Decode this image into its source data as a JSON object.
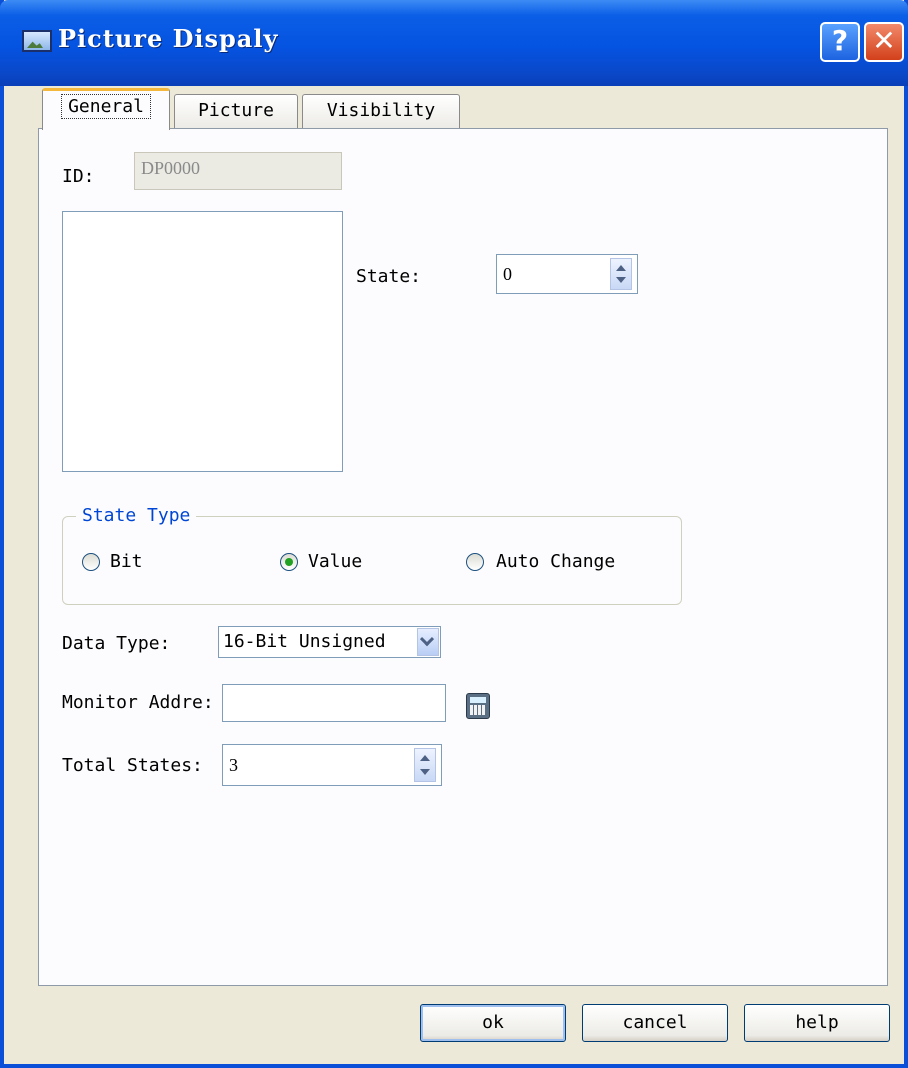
{
  "window": {
    "title": "Picture Dispaly"
  },
  "title_buttons": {
    "help": "?",
    "close": "✕"
  },
  "tabs": [
    {
      "label": "General"
    },
    {
      "label": "Picture"
    },
    {
      "label": "Visibility"
    }
  ],
  "general": {
    "id_label": "ID:",
    "id_value": "DP0000",
    "state_label": "State:",
    "state_value": "0",
    "state_type": {
      "title": "State Type",
      "options": [
        {
          "label": "Bit",
          "selected": false
        },
        {
          "label": "Value",
          "selected": true
        },
        {
          "label": "Auto Change",
          "selected": false
        }
      ]
    },
    "data_type_label": "Data Type:",
    "data_type_value": "16-Bit Unsigned",
    "monitor_label": "Monitor Addre:",
    "monitor_value": "",
    "total_states_label": "Total States:",
    "total_states_value": "3"
  },
  "buttons": {
    "ok": "ok",
    "cancel": "cancel",
    "help": "help"
  },
  "icons": [
    "picture-window-icon",
    "help-icon",
    "close-icon",
    "spinner-icon",
    "dropdown-arrow-icon",
    "calculator-icon"
  ],
  "colors": {
    "titlebar": "#0553e1",
    "group_title": "#0046d5",
    "radio_dot": "#21a121"
  }
}
